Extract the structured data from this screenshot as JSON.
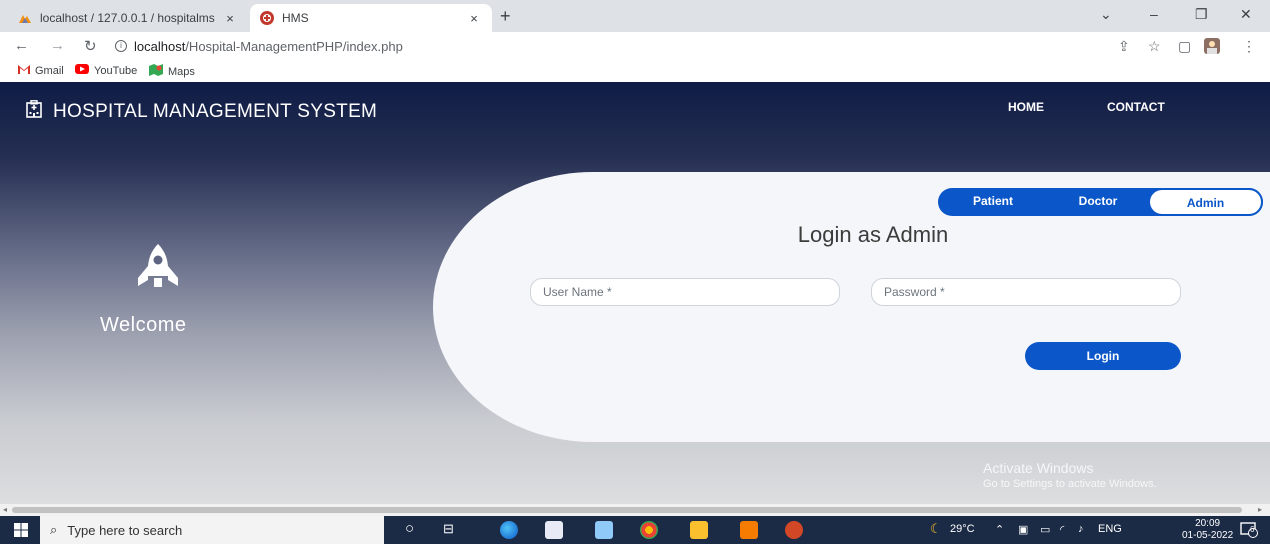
{
  "browser": {
    "tabs": [
      {
        "title": "localhost / 127.0.0.1 / hospitalms",
        "favicon": "phpmyadmin-icon",
        "close": "×",
        "active": false
      },
      {
        "title": "HMS",
        "favicon": "hospital-icon",
        "close": "×",
        "active": true
      }
    ],
    "new_tab": "+",
    "window_controls": {
      "minimize": "–",
      "restore": "❐",
      "close": "✕",
      "tab_search": "⌄"
    },
    "url_host": "localhost",
    "url_path": "/Hospital-ManagementPHP/index.php",
    "bookmarks": [
      {
        "label": "Gmail",
        "icon": "gmail-icon"
      },
      {
        "label": "YouTube",
        "icon": "youtube-icon"
      },
      {
        "label": "Maps",
        "icon": "maps-icon"
      }
    ]
  },
  "page": {
    "brand": "HOSPITAL MANAGEMENT SYSTEM",
    "nav": {
      "home": "HOME",
      "contact": "CONTACT"
    },
    "welcome": "Welcome",
    "role_switch": {
      "patient": "Patient",
      "doctor": "Doctor",
      "admin": "Admin",
      "selected": "Admin"
    },
    "login_title": "Login as Admin",
    "username_placeholder": "User Name *",
    "password_placeholder": "Password *",
    "login_button": "Login",
    "colors": {
      "primary": "#0b57c9",
      "header_dark": "#0f1c45",
      "panel": "#f5f6f9"
    }
  },
  "watermark": {
    "line1": "Activate Windows",
    "line2": "Go to Settings to activate Windows."
  },
  "taskbar": {
    "search_placeholder": "Type here to search",
    "temperature": "29°C",
    "language": "ENG",
    "time": "20:09",
    "date": "01-05-2022",
    "notification_count": "6"
  }
}
